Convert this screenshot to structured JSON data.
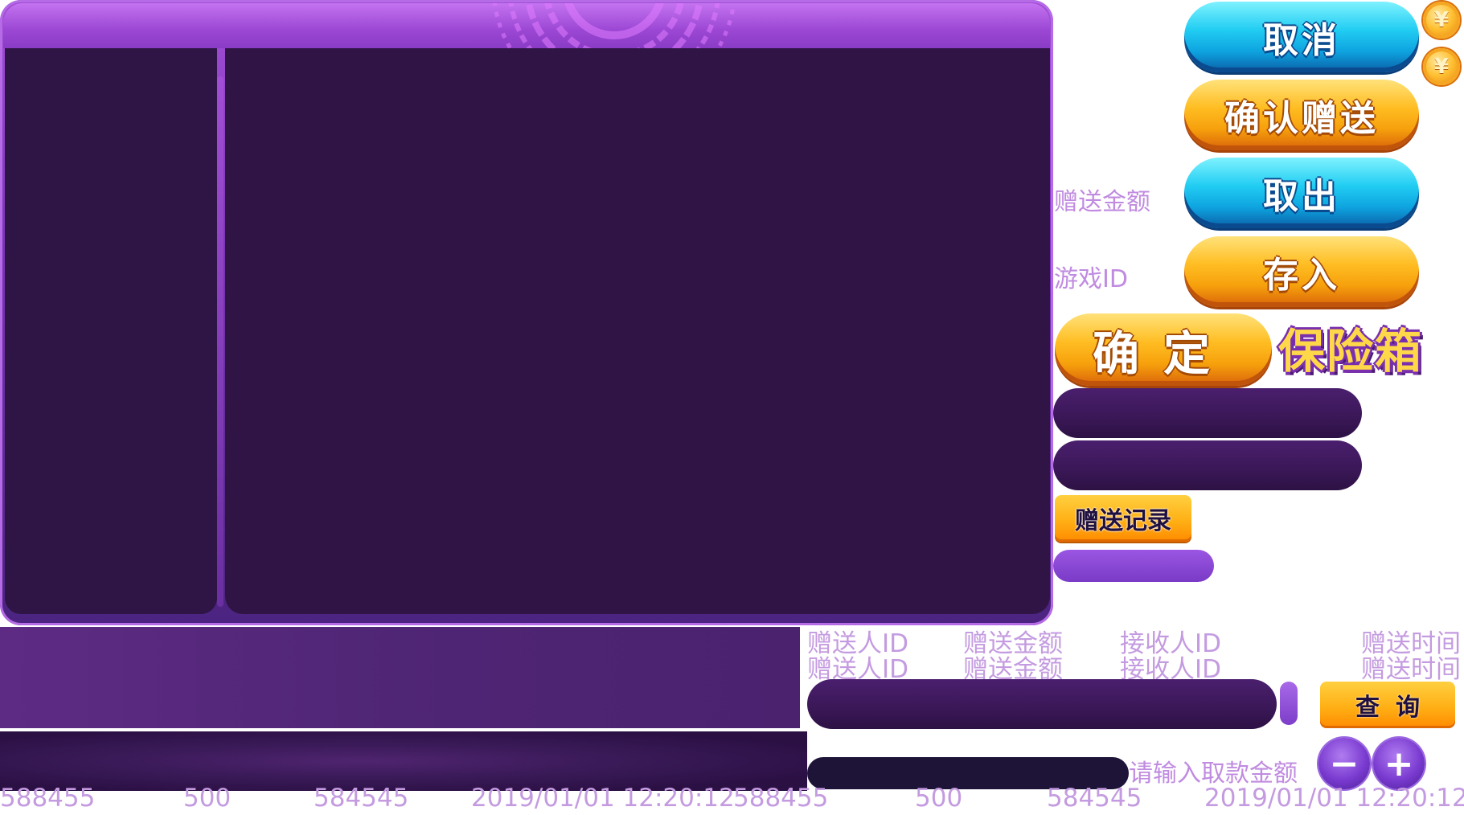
{
  "buttons": {
    "cancel": "取消",
    "confirm_give": "确认赠送",
    "withdraw": "取出",
    "deposit": "存入",
    "ok": "确定",
    "give_record": "赠送记录",
    "query": "查询",
    "minus": "−",
    "plus": "+"
  },
  "labels": {
    "give_amount": "赠送金额",
    "game_id": "游戏ID",
    "withdraw_hint": "请输入取款金额"
  },
  "coin_symbol": "¥",
  "title": "保险箱",
  "table_headers": [
    {
      "giver_id": "赠送人ID",
      "amount": "赠送金额",
      "receiver_id": "接收人ID",
      "time": "赠送时间"
    },
    {
      "giver_id": "赠送人ID",
      "amount": "赠送金额",
      "receiver_id": "接收人ID",
      "time": "赠送时间"
    }
  ],
  "records": [
    {
      "giver_id": "588455",
      "amount": "500",
      "receiver_id": "584545",
      "time": "2019/01/01 12:20:12"
    },
    {
      "giver_id": "588455",
      "amount": "500",
      "receiver_id": "584545",
      "time": "2019/01/01 12:20:12"
    }
  ],
  "colors": {
    "panel_purple": "#311446",
    "accent_cyan": "#21cdf2",
    "accent_orange": "#ffbd22",
    "label_text": "#c08be0"
  }
}
